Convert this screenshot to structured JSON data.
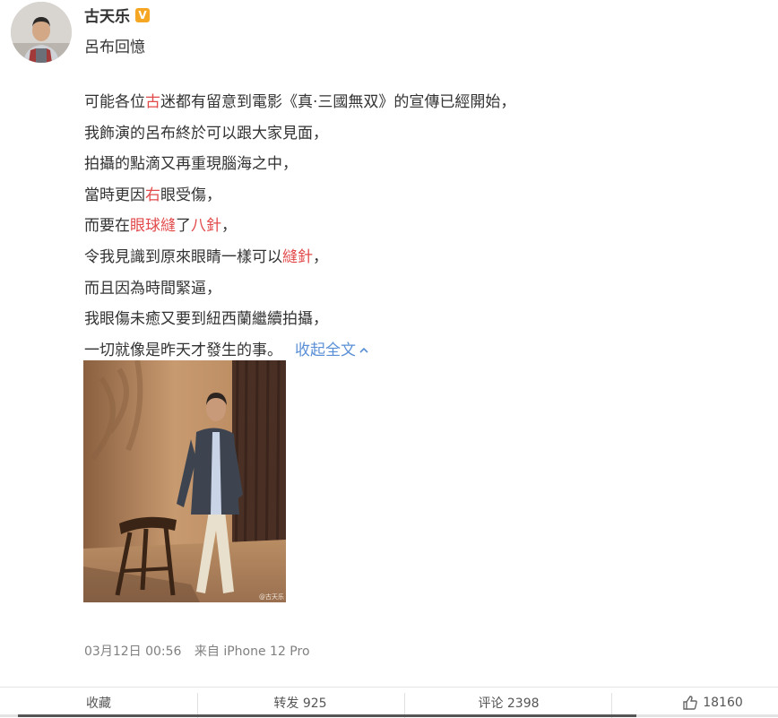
{
  "post": {
    "username": "古天乐",
    "subtitle": "呂布回憶",
    "lines": [
      [
        {
          "t": "可能各位"
        },
        {
          "t": "古",
          "h": true
        },
        {
          "t": "迷都有留意到電影《真·三國無双》的宣傳已經開始，"
        }
      ],
      [
        {
          "t": "我飾演的呂布終於可以跟大家見面，"
        }
      ],
      [
        {
          "t": "拍攝的點滴又再重現腦海之中，"
        }
      ],
      [
        {
          "t": "當時更因"
        },
        {
          "t": "右",
          "h": true
        },
        {
          "t": "眼受傷，"
        }
      ],
      [
        {
          "t": "而要在"
        },
        {
          "t": "眼球縫",
          "h": true
        },
        {
          "t": "了"
        },
        {
          "t": "八針",
          "h": true
        },
        {
          "t": "，"
        }
      ],
      [
        {
          "t": "令我見識到原來眼睛一樣可以"
        },
        {
          "t": "縫針",
          "h": true
        },
        {
          "t": "，"
        }
      ],
      [
        {
          "t": "而且因為時間緊逼，"
        }
      ],
      [
        {
          "t": "我眼傷未癒又要到紐西蘭繼續拍攝，"
        }
      ],
      [
        {
          "t": "一切就像是昨天才發生的事。"
        }
      ]
    ],
    "collapse_label": "收起全文",
    "date": "03月12日 00:56",
    "source": "来自 iPhone 12 Pro",
    "photo_watermark": "@古天乐"
  },
  "actions": {
    "favorite": "收藏",
    "repost": "转发 925",
    "comment": "评论 2398",
    "like": "18160"
  },
  "colors": {
    "highlight": "#e2494a",
    "link": "#5a8fd6",
    "verified": "#f5a623"
  },
  "icons": {
    "verified": "verified-badge-icon",
    "collapse": "chevron-up-icon",
    "like": "thumbs-up-icon"
  }
}
